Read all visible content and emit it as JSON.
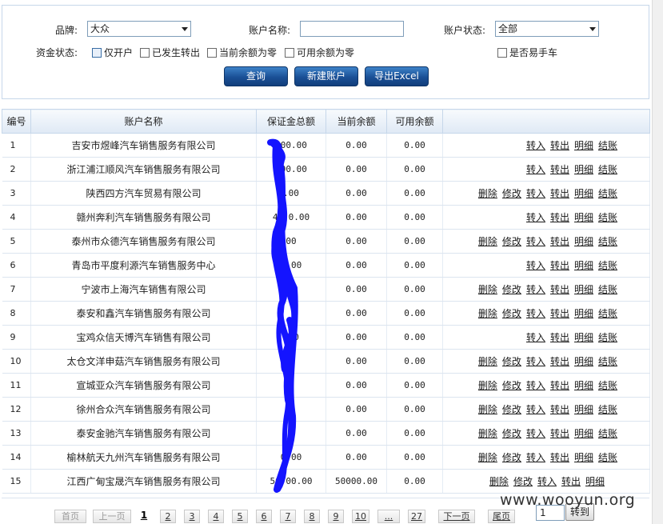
{
  "filters": {
    "brand_label": "品牌:",
    "brand_value": "大众",
    "account_name_label": "账户名称:",
    "account_name_value": "",
    "account_status_label": "账户状态:",
    "account_status_value": "全部",
    "fund_status_label": "资金状态:",
    "checkboxes": [
      {
        "label": "仅开户",
        "checked": false
      },
      {
        "label": "已发生转出",
        "checked": false
      },
      {
        "label": "当前余额为零",
        "checked": false
      },
      {
        "label": "可用余额为零",
        "checked": false
      }
    ],
    "easy_handoff_label": "是否易手车"
  },
  "buttons": {
    "query": "查询",
    "new_account": "新建账户",
    "export": "导出Excel"
  },
  "table": {
    "headers": [
      "编号",
      "账户名称",
      "保证金总额",
      "当前余额",
      "可用余额",
      ""
    ],
    "rows": [
      {
        "id": "1",
        "name": "吉安市煜峰汽车销售服务有限公司",
        "deposit": "000.00",
        "current": "0.00",
        "available": "0.00",
        "ops": [
          "转入",
          "转出",
          "明细",
          "结账"
        ]
      },
      {
        "id": "2",
        "name": "浙江浦江顺风汽车销售服务有限公司",
        "deposit": "000.00",
        "current": "0.00",
        "available": "0.00",
        "ops": [
          "转入",
          "转出",
          "明细",
          "结账"
        ]
      },
      {
        "id": "3",
        "name": "陕西四方汽车贸易有限公司",
        "deposit": ".00",
        "current": "0.00",
        "available": "0.00",
        "ops": [
          "删除",
          "修改",
          "转入",
          "转出",
          "明细",
          "结账"
        ]
      },
      {
        "id": "4",
        "name": "赣州奔利汽车销售服务有限公司",
        "deposit": "45 0.00",
        "current": "0.00",
        "available": "0.00",
        "ops": [
          "转入",
          "转出",
          "明细",
          "结账"
        ]
      },
      {
        "id": "5",
        "name": "泰州市众德汽车销售服务有限公司",
        "deposit": "00",
        "current": "0.00",
        "available": "0.00",
        "ops": [
          "删除",
          "修改",
          "转入",
          "转出",
          "明细",
          "结账"
        ]
      },
      {
        "id": "6",
        "name": "青岛市平度利源汽车销售服务中心",
        "deposit": "0.00",
        "current": "0.00",
        "available": "0.00",
        "ops": [
          "转入",
          "转出",
          "明细",
          "结账"
        ]
      },
      {
        "id": "7",
        "name": "宁波市上海汽车销售有限公司",
        "deposit": "0",
        "current": "0.00",
        "available": "0.00",
        "ops": [
          "删除",
          "修改",
          "转入",
          "转出",
          "明细",
          "结账"
        ]
      },
      {
        "id": "8",
        "name": "泰安和鑫汽车销售服务有限公司",
        "deposit": "",
        "current": "0.00",
        "available": "0.00",
        "ops": [
          "删除",
          "修改",
          "转入",
          "转出",
          "明细",
          "结账"
        ]
      },
      {
        "id": "9",
        "name": "宝鸡众信天博汽车销售有限公司",
        "deposit": "450",
        "current": "0.00",
        "available": "0.00",
        "ops": [
          "转入",
          "转出",
          "明细",
          "结账"
        ]
      },
      {
        "id": "10",
        "name": "太仓文洋申菇汽车销售服务有限公司",
        "deposit": "",
        "current": "0.00",
        "available": "0.00",
        "ops": [
          "删除",
          "修改",
          "转入",
          "转出",
          "明细",
          "结账"
        ]
      },
      {
        "id": "11",
        "name": "宣城亚众汽车销售服务有限公司",
        "deposit": "0",
        "current": "0.00",
        "available": "0.00",
        "ops": [
          "删除",
          "修改",
          "转入",
          "转出",
          "明细",
          "结账"
        ]
      },
      {
        "id": "12",
        "name": "徐州合众汽车销售服务有限公司",
        "deposit": "",
        "current": "0.00",
        "available": "0.00",
        "ops": [
          "删除",
          "修改",
          "转入",
          "转出",
          "明细",
          "结账"
        ]
      },
      {
        "id": "13",
        "name": "泰安金驰汽车销售服务有限公司",
        "deposit": "",
        "current": "0.00",
        "available": "0.00",
        "ops": [
          "删除",
          "修改",
          "转入",
          "转出",
          "明细",
          "结账"
        ]
      },
      {
        "id": "14",
        "name": "榆林航天九州汽车销售服务有限公司",
        "deposit": "0.00",
        "current": "0.00",
        "available": "0.00",
        "ops": [
          "删除",
          "修改",
          "转入",
          "转出",
          "明细",
          "结账"
        ]
      },
      {
        "id": "15",
        "name": "江西广甸宝晟汽车销售服务有限公司",
        "deposit": "50 00.00",
        "current": "50000.00",
        "available": "0.00",
        "ops": [
          "删除",
          "修改",
          "转入",
          "转出",
          "明细"
        ]
      }
    ]
  },
  "pager": {
    "first": "首页",
    "prev": "上一页",
    "pages": [
      "1",
      "2",
      "3",
      "4",
      "5",
      "6",
      "7",
      "8",
      "9",
      "10",
      "...",
      "27"
    ],
    "current": "1",
    "next": "下一页",
    "last": "尾页",
    "goto_value": "1",
    "goto_label": "转到"
  },
  "watermark": "www.wooyun.org",
  "colors": {
    "button_blue": "#1a4f95",
    "scribble": "#1414ff",
    "header_bg": "#dfe9f5"
  }
}
